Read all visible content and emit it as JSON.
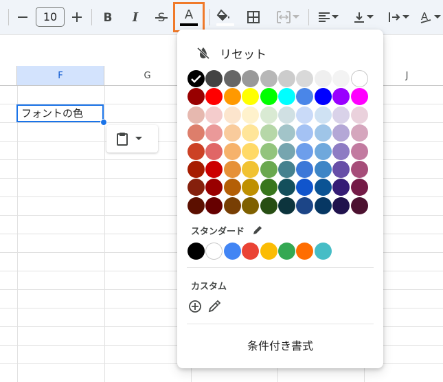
{
  "toolbar": {
    "font_size": "10",
    "icons": [
      "minus-icon",
      "plus-icon",
      "bold-icon",
      "italic-icon",
      "strikethrough-icon",
      "text-color-icon",
      "fill-color-icon",
      "borders-icon",
      "merge-cells-icon",
      "align-left-icon",
      "vertical-align-icon",
      "text-wrap-icon",
      "text-rotation-icon"
    ],
    "text_color_underline": "#000000",
    "fill_color_underline": "#ffffff"
  },
  "grid": {
    "columns": [
      "F",
      "G",
      "J"
    ],
    "selected_column": "F",
    "active_cell_value": "フォントの色"
  },
  "color_panel": {
    "reset_label": "リセット",
    "palette": [
      [
        "#000000",
        "#434343",
        "#666666",
        "#999999",
        "#b7b7b7",
        "#cccccc",
        "#d9d9d9",
        "#efefef",
        "#f3f3f3",
        "#ffffff"
      ],
      [
        "#980000",
        "#ff0000",
        "#ff9900",
        "#ffff00",
        "#00ff00",
        "#00ffff",
        "#4a86e8",
        "#0000ff",
        "#9900ff",
        "#ff00ff"
      ],
      [
        "#e6b8af",
        "#f4cccc",
        "#fce5cd",
        "#fff2cc",
        "#d9ead3",
        "#d0e0e3",
        "#c9daf8",
        "#cfe2f3",
        "#d9d2e9",
        "#ead1dc"
      ],
      [
        "#dd7e6b",
        "#ea9999",
        "#f9cb9c",
        "#ffe599",
        "#b6d7a8",
        "#a2c4c9",
        "#a4c2f4",
        "#9fc5e8",
        "#b4a7d6",
        "#d5a6bd"
      ],
      [
        "#cc4125",
        "#e06666",
        "#f6b26b",
        "#ffd966",
        "#93c47d",
        "#76a5af",
        "#6d9eeb",
        "#6fa8dc",
        "#8e7cc3",
        "#c27ba0"
      ],
      [
        "#a61c00",
        "#cc0000",
        "#e69138",
        "#f1c232",
        "#6aa84f",
        "#45818e",
        "#3c78d8",
        "#3d85c6",
        "#674ea7",
        "#a64d79"
      ],
      [
        "#85200c",
        "#990000",
        "#b45f06",
        "#bf9000",
        "#38761d",
        "#134f5c",
        "#1155cc",
        "#0b5394",
        "#351c75",
        "#741b47"
      ],
      [
        "#5b0f00",
        "#660000",
        "#783f04",
        "#7f6000",
        "#274e13",
        "#0c343d",
        "#1c4587",
        "#073763",
        "#20124d",
        "#4c1130"
      ]
    ],
    "selected_color": "#000000",
    "standard_label": "スタンダード",
    "standard_colors": [
      "#000000",
      "#ffffff",
      "#4285f4",
      "#ea4335",
      "#fbbc04",
      "#34a853",
      "#ff6d01",
      "#46bdc6"
    ],
    "custom_label": "カスタム",
    "conditional_format_label": "条件付き書式"
  }
}
